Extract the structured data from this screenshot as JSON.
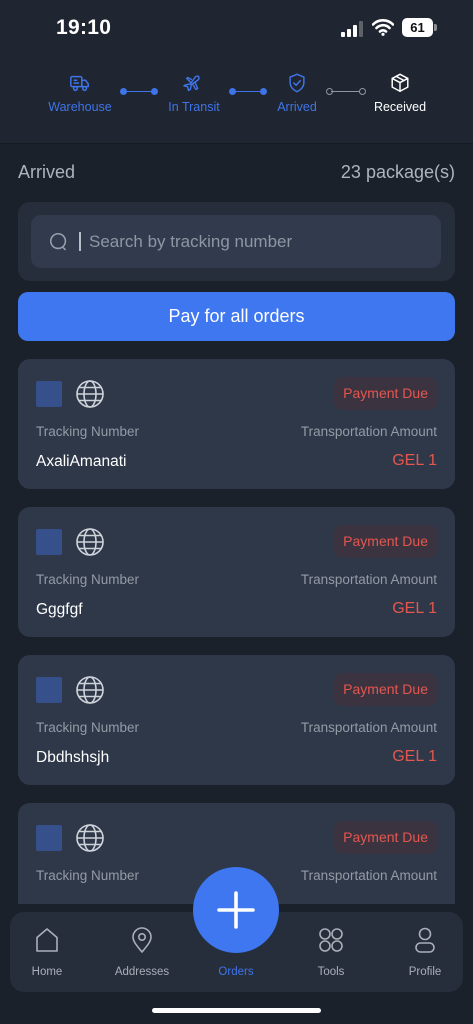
{
  "status_bar": {
    "time": "19:10",
    "battery": "61"
  },
  "progress": {
    "steps": [
      {
        "label": "Warehouse",
        "icon": "truck-icon",
        "state": "active"
      },
      {
        "label": "In Transit",
        "icon": "airplane-icon",
        "state": "active"
      },
      {
        "label": "Arrived",
        "icon": "shield-check-icon",
        "state": "active"
      },
      {
        "label": "Received",
        "icon": "box-icon",
        "state": "done"
      }
    ]
  },
  "section": {
    "title": "Arrived",
    "count": "23 package(s)"
  },
  "search": {
    "placeholder": "Search by tracking number",
    "value": ""
  },
  "pay_all_label": "Pay for all orders",
  "orders": [
    {
      "badge": "Payment Due",
      "tracking_label": "Tracking Number",
      "amount_label": "Transportation Amount",
      "tracking": "AxaliAmanati",
      "amount": "GEL 1"
    },
    {
      "badge": "Payment Due",
      "tracking_label": "Tracking Number",
      "amount_label": "Transportation Amount",
      "tracking": "Gggfgf",
      "amount": "GEL 1"
    },
    {
      "badge": "Payment Due",
      "tracking_label": "Tracking Number",
      "amount_label": "Transportation Amount",
      "tracking": "Dbdhshsjh",
      "amount": "GEL 1"
    },
    {
      "badge": "Payment Due",
      "tracking_label": "Tracking Number",
      "amount_label": "Transportation Amount",
      "tracking": "",
      "amount": ""
    }
  ],
  "tabbar": {
    "items": [
      {
        "label": "Home",
        "icon": "home-icon"
      },
      {
        "label": "Addresses",
        "icon": "location-pin-icon"
      },
      {
        "label": "Orders",
        "icon": "orders-icon",
        "active": true
      },
      {
        "label": "Tools",
        "icon": "grid-icon"
      },
      {
        "label": "Profile",
        "icon": "profile-icon"
      }
    ]
  },
  "colors": {
    "accent": "#3e77f0",
    "background": "#1b212b",
    "card": "#2e3849",
    "danger": "#e5564f",
    "badge_bg": "#3b3440"
  }
}
